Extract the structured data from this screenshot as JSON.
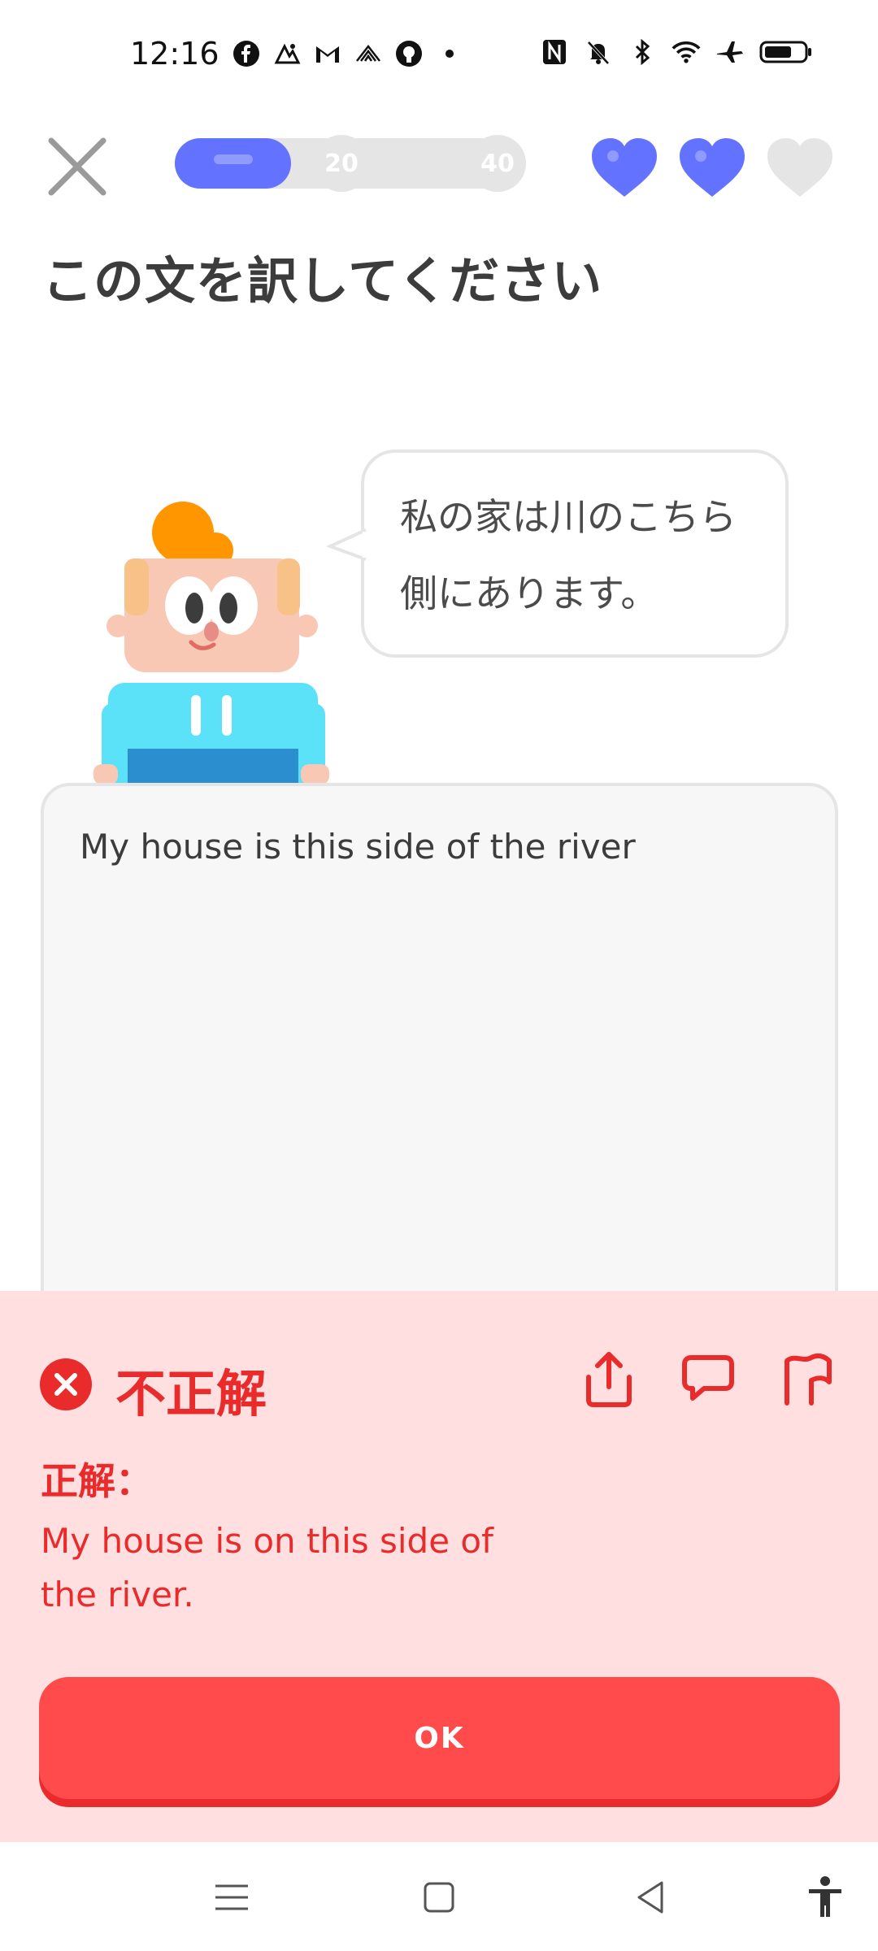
{
  "status_bar": {
    "time": "12:16",
    "left_icons": [
      "facebook-icon",
      "photos-icon",
      "gmail-icon",
      "app-icon",
      "github-icon",
      "dot-icon"
    ],
    "right_icons": [
      "nfc-icon",
      "mute-icon",
      "bluetooth-icon",
      "wifi-icon",
      "airplane-icon",
      "battery-icon"
    ]
  },
  "header": {
    "progress_fraction": 0.33,
    "milestones": [
      "20",
      "40"
    ],
    "hearts": [
      {
        "state": "full",
        "color": "#6373ff"
      },
      {
        "state": "full",
        "color": "#6373ff"
      },
      {
        "state": "empty",
        "color": "#e5e5e5"
      }
    ]
  },
  "prompt": {
    "title": "この文を訳してください",
    "sentence_line1": "私の家は川のこちら",
    "sentence_line2": "側にあります。"
  },
  "answer": {
    "text": "My house is this side of the river"
  },
  "feedback": {
    "title": "不正解",
    "label": "正解：",
    "correct_answer_line1": "My house is on this side of",
    "correct_answer_line2": "the river.",
    "ok_label": "OK",
    "actions": [
      "share-icon",
      "comment-icon",
      "flag-icon"
    ],
    "colors": {
      "background": "#ffdfe0",
      "accent": "#ea2b2b",
      "button": "#ff4b4b"
    }
  },
  "navbar": {
    "items": [
      "menu-icon",
      "home-icon",
      "back-icon",
      "accessibility-icon"
    ]
  }
}
